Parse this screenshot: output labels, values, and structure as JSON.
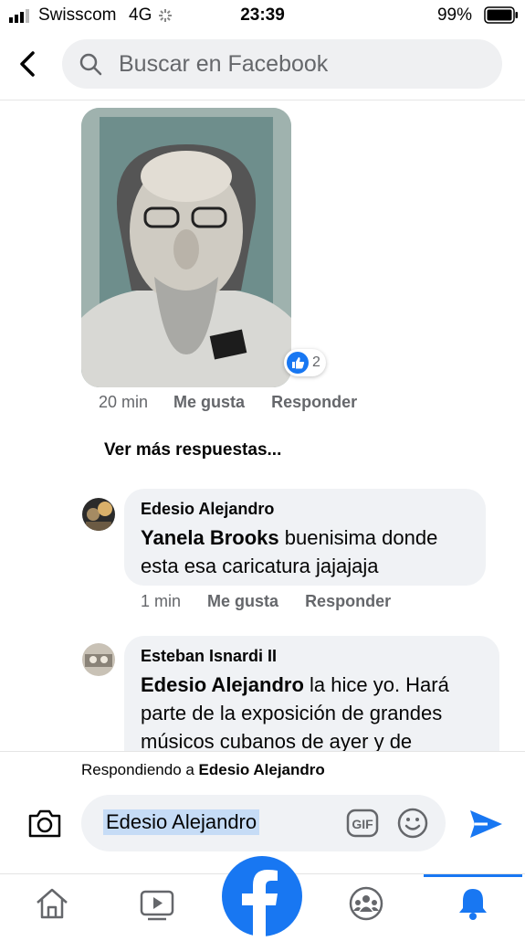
{
  "status_bar": {
    "carrier": "Swisscom",
    "network": "4G",
    "time": "23:39",
    "battery": "99%"
  },
  "header": {
    "search_placeholder": "Buscar en Facebook"
  },
  "photo_comment": {
    "reaction_count": "2",
    "time": "20 min",
    "like": "Me gusta",
    "reply": "Responder"
  },
  "more_replies": "Ver más respuestas...",
  "comments": [
    {
      "author": "Edesio Alejandro",
      "mention": "Yanela Brooks",
      "text_line1_rest": " buenisima donde",
      "text_line2": "esta esa caricatura jajajaja",
      "time": "1 min",
      "like": "Me gusta",
      "reply": "Responder"
    },
    {
      "author": "Esteban Isnardi II",
      "mention": "Edesio Alejandro",
      "text_line1_rest": " la hice yo. Hará",
      "text_line2": "parte de la exposición de grandes",
      "text_line3": "músicos cubanos de ayer y de"
    }
  ],
  "reply_bar": {
    "prefix": "Respondiendo a ",
    "target": "Edesio Alejandro",
    "input_value": "Edesio Alejandro"
  },
  "colors": {
    "accent": "#1877f2",
    "bubble": "#f0f2f5",
    "muted": "#65676b"
  }
}
